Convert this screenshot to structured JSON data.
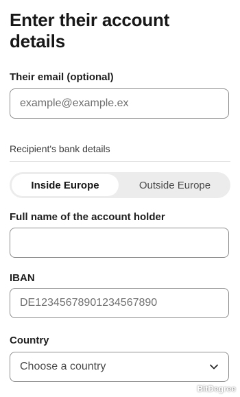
{
  "header": {
    "title": "Enter their account details"
  },
  "email": {
    "label": "Their email (optional)",
    "placeholder": "example@example.ex",
    "value": ""
  },
  "bank_details": {
    "section_label": "Recipient's bank details",
    "tabs": [
      {
        "label": "Inside Europe",
        "selected": true
      },
      {
        "label": "Outside Europe",
        "selected": false
      }
    ]
  },
  "full_name": {
    "label": "Full name of the account holder",
    "placeholder": "",
    "value": ""
  },
  "iban": {
    "label": "IBAN",
    "placeholder": "DE12345678901234567890",
    "value": ""
  },
  "country": {
    "label": "Country",
    "selected_value": "Choose a country",
    "icon": "chevron-down-icon"
  },
  "watermark": {
    "text": "BitDegree",
    "icon": "bitdegree-logo-icon"
  },
  "colors": {
    "border": "#8c8c8c",
    "segment_bg": "#ececec",
    "text": "#1f1f1f"
  }
}
